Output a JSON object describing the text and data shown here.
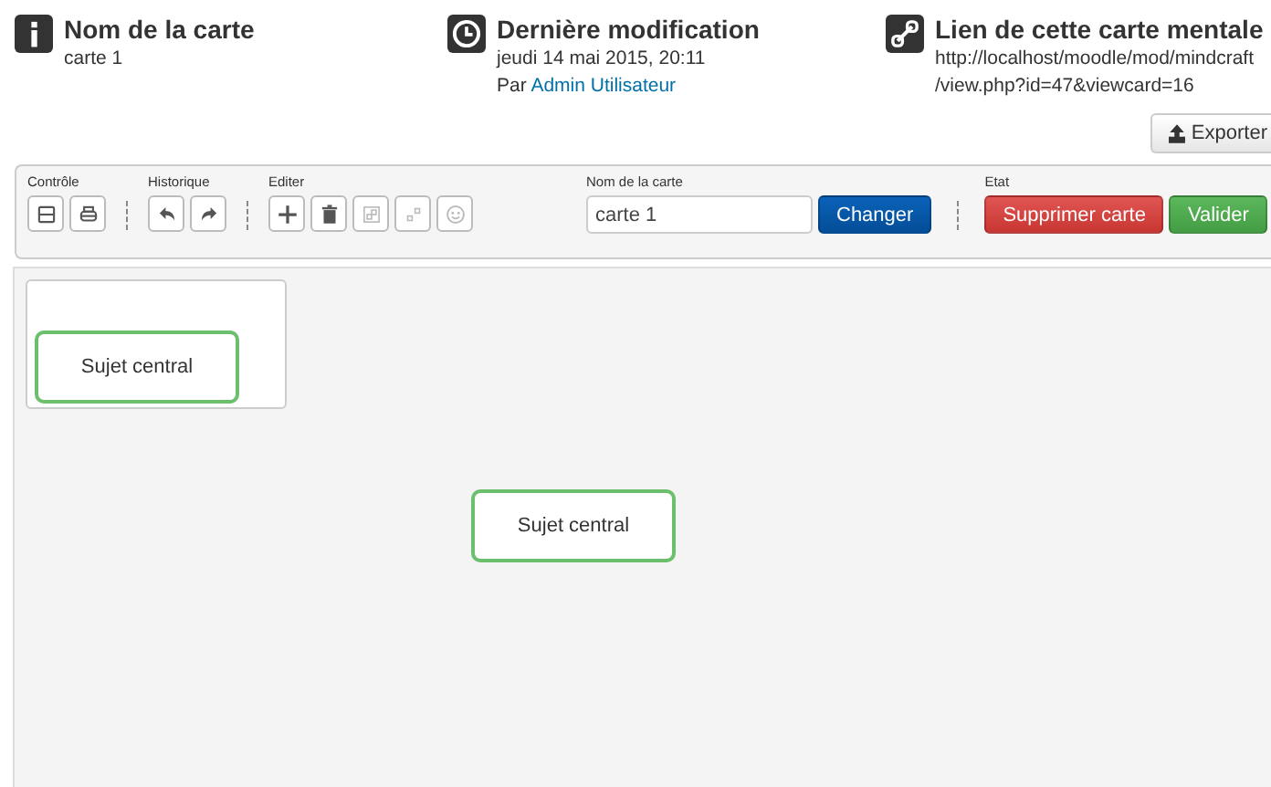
{
  "info": [
    {
      "kind": "info",
      "title": "Nom de la carte",
      "lines": [
        "carte 1"
      ]
    },
    {
      "kind": "clock",
      "title": "Dernière modification",
      "lines": [
        "jeudi 14 mai 2015, 20:11"
      ],
      "by_prefix": "Par",
      "by_link": "Admin Utilisateur"
    },
    {
      "kind": "link",
      "title": "Lien de cette carte mentale",
      "lines": [
        "http://localhost/moodle/mod/mindcraft",
        "/view.php?id=47&viewcard=16"
      ]
    }
  ],
  "export_button": "Exporter",
  "toolbar": {
    "groups": [
      {
        "label": "Contrôle",
        "tools": [
          {
            "kind": "save",
            "disabled": false
          },
          {
            "kind": "print",
            "disabled": false
          }
        ]
      },
      {
        "label": "Historique",
        "tools": [
          {
            "kind": "undo",
            "disabled": false
          },
          {
            "kind": "redo",
            "disabled": false
          }
        ]
      },
      {
        "label": "Editer",
        "tools": [
          {
            "kind": "add",
            "disabled": false
          },
          {
            "kind": "delete",
            "disabled": false
          },
          {
            "kind": "group",
            "disabled": true
          },
          {
            "kind": "ungroup",
            "disabled": true
          },
          {
            "kind": "emoji",
            "disabled": true
          }
        ]
      }
    ],
    "name_label": "Nom de la carte",
    "name_value": "carte 1",
    "change_button": "Changer",
    "state_label": "Etat",
    "delete_button": "Supprimer carte",
    "validate_button": "Valider"
  },
  "minimap": {
    "node": "Sujet central"
  },
  "canvas": {
    "node": "Sujet central"
  }
}
